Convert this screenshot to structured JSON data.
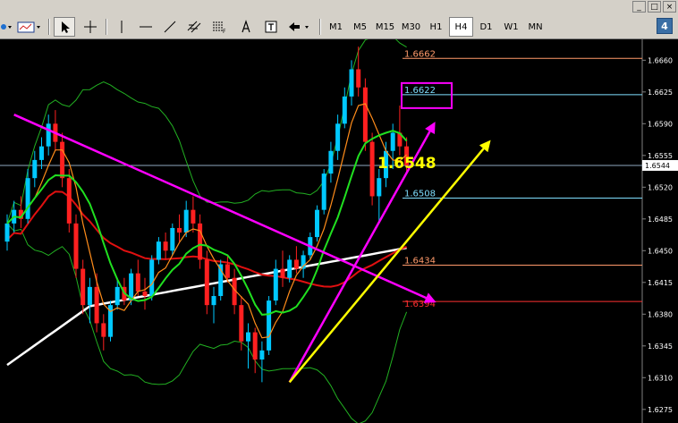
{
  "toolbar": {
    "timeframes": [
      "M1",
      "M5",
      "M15",
      "M30",
      "H1",
      "H4",
      "D1",
      "W1",
      "MN"
    ],
    "active_timeframe": "H4",
    "tool_icons": [
      "cursor-arrow-icon",
      "crosshair-icon",
      "vertical-line-icon",
      "horizontal-line-icon",
      "trendline-icon",
      "equidistant-channel-icon",
      "fibonacci-icon",
      "text-icon",
      "text-label-icon",
      "arrows-dropdown-icon"
    ],
    "badge": "4"
  },
  "window_controls": [
    "_",
    "□",
    "×"
  ],
  "colors": {
    "background": "#000000",
    "bull_candle": "#00c8ff",
    "bear_candle": "#ff2020",
    "ma_fast": "#ff8c1a",
    "ma_mid": "#20e020",
    "ma_slow": "#e01010",
    "ma_long": "#ffffff",
    "bollinger": "#22b022",
    "magenta": "#ff00ff",
    "yellow": "#ffff00"
  },
  "price_axis": {
    "labels": [
      "1.6660",
      "1.6625",
      "1.6590",
      "1.6555",
      "1.6520",
      "1.6485",
      "1.6450",
      "1.6415",
      "1.6380",
      "1.6345",
      "1.6310",
      "1.6275"
    ],
    "current_price": "1.6544"
  },
  "chart_data": {
    "type": "candlestick",
    "price_range": [
      1.626,
      1.6683
    ],
    "fib_levels": [
      {
        "label": "1.6662",
        "price": 1.6662,
        "color": "#ff9a6a"
      },
      {
        "label": "1.6622",
        "price": 1.6622,
        "color": "#7fdfff"
      },
      {
        "label": "1.6508",
        "price": 1.6508,
        "color": "#7fdfff"
      },
      {
        "label": "1.6434",
        "price": 1.6434,
        "color": "#ff9a6a"
      },
      {
        "label": "1.6394",
        "price": 1.6394,
        "color": "#ff3030"
      }
    ],
    "annotation": {
      "label": "1.6548",
      "price": 1.6548
    },
    "ohlc": [
      [
        1.646,
        1.649,
        1.645,
        1.648
      ],
      [
        1.648,
        1.6505,
        1.647,
        1.6495
      ],
      [
        1.6495,
        1.651,
        1.6475,
        1.6485
      ],
      [
        1.6485,
        1.654,
        1.648,
        1.653
      ],
      [
        1.653,
        1.656,
        1.652,
        1.655
      ],
      [
        1.655,
        1.6575,
        1.654,
        1.6565
      ],
      [
        1.6565,
        1.66,
        1.6555,
        1.659
      ],
      [
        1.659,
        1.6605,
        1.656,
        1.657
      ],
      [
        1.657,
        1.658,
        1.652,
        1.653
      ],
      [
        1.653,
        1.654,
        1.647,
        1.648
      ],
      [
        1.648,
        1.649,
        1.642,
        1.643
      ],
      [
        1.643,
        1.644,
        1.638,
        1.639
      ],
      [
        1.639,
        1.642,
        1.637,
        1.641
      ],
      [
        1.641,
        1.6425,
        1.636,
        1.637
      ],
      [
        1.637,
        1.638,
        1.634,
        1.6355
      ],
      [
        1.6355,
        1.6395,
        1.635,
        1.639
      ],
      [
        1.639,
        1.642,
        1.6385,
        1.641
      ],
      [
        1.641,
        1.642,
        1.639,
        1.6395
      ],
      [
        1.6395,
        1.643,
        1.639,
        1.6425
      ],
      [
        1.6425,
        1.644,
        1.64,
        1.6405
      ],
      [
        1.6405,
        1.642,
        1.6385,
        1.64
      ],
      [
        1.64,
        1.6445,
        1.6395,
        1.644
      ],
      [
        1.644,
        1.6465,
        1.6435,
        1.646
      ],
      [
        1.646,
        1.647,
        1.644,
        1.645
      ],
      [
        1.645,
        1.648,
        1.6445,
        1.6475
      ],
      [
        1.6475,
        1.649,
        1.646,
        1.647
      ],
      [
        1.647,
        1.6505,
        1.6465,
        1.6495
      ],
      [
        1.6495,
        1.651,
        1.647,
        1.648
      ],
      [
        1.648,
        1.649,
        1.643,
        1.644
      ],
      [
        1.644,
        1.645,
        1.638,
        1.639
      ],
      [
        1.639,
        1.641,
        1.637,
        1.64
      ],
      [
        1.64,
        1.644,
        1.6395,
        1.6435
      ],
      [
        1.6435,
        1.6445,
        1.6415,
        1.642
      ],
      [
        1.642,
        1.643,
        1.638,
        1.639
      ],
      [
        1.639,
        1.64,
        1.634,
        1.635
      ],
      [
        1.635,
        1.637,
        1.632,
        1.636
      ],
      [
        1.636,
        1.6365,
        1.6315,
        1.633
      ],
      [
        1.633,
        1.635,
        1.6305,
        1.634
      ],
      [
        1.634,
        1.64,
        1.6335,
        1.6395
      ],
      [
        1.6395,
        1.644,
        1.639,
        1.643
      ],
      [
        1.643,
        1.645,
        1.641,
        1.642
      ],
      [
        1.642,
        1.6445,
        1.6415,
        1.644
      ],
      [
        1.644,
        1.6455,
        1.6425,
        1.643
      ],
      [
        1.643,
        1.645,
        1.642,
        1.6445
      ],
      [
        1.6445,
        1.647,
        1.644,
        1.6465
      ],
      [
        1.6465,
        1.65,
        1.646,
        1.6495
      ],
      [
        1.6495,
        1.654,
        1.649,
        1.6535
      ],
      [
        1.6535,
        1.657,
        1.6525,
        1.656
      ],
      [
        1.656,
        1.66,
        1.655,
        1.659
      ],
      [
        1.659,
        1.663,
        1.6585,
        1.662
      ],
      [
        1.662,
        1.666,
        1.661,
        1.665
      ],
      [
        1.665,
        1.6675,
        1.662,
        1.663
      ],
      [
        1.663,
        1.664,
        1.656,
        1.657
      ],
      [
        1.657,
        1.658,
        1.65,
        1.651
      ],
      [
        1.651,
        1.654,
        1.648,
        1.653
      ],
      [
        1.653,
        1.657,
        1.652,
        1.656
      ],
      [
        1.656,
        1.659,
        1.654,
        1.658
      ],
      [
        1.658,
        1.661,
        1.6555,
        1.6565
      ],
      [
        1.6565,
        1.6575,
        1.6535,
        1.6544
      ]
    ],
    "drawings": [
      {
        "name": "magenta-trendline",
        "color": "#ff00ff",
        "from": [
          1,
          1.66
        ],
        "to": [
          62,
          1.6394
        ]
      },
      {
        "name": "magenta-arrow",
        "color": "#ff00ff",
        "from": [
          41,
          1.6305
        ],
        "to": [
          62,
          1.659
        ]
      },
      {
        "name": "yellow-arrow",
        "color": "#ffff00",
        "from": [
          41,
          1.6305
        ],
        "to": [
          70,
          1.657
        ]
      }
    ]
  }
}
